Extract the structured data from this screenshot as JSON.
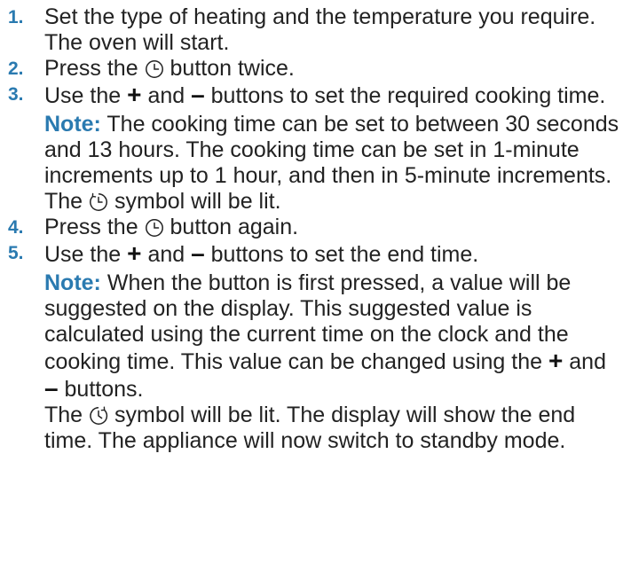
{
  "steps": [
    {
      "number": "1.",
      "line1": "Set the type of heating and the temperature you require.",
      "line2": "The oven will start."
    },
    {
      "number": "2.",
      "before_icon": "Press the",
      "icon": "clock-icon",
      "after_icon": "button twice."
    },
    {
      "number": "3.",
      "before_plus": "Use the",
      "plus": "+",
      "and": "and",
      "minus": "–",
      "after_minus": "buttons to set the required cooking time.",
      "note_label": "Note:",
      "note_text": "The cooking time can be set to between 30 seconds and 13 hours. The cooking time can be set in 1-minute increments up to 1 hour, and then in 5-minute increments.",
      "lit_before": "The",
      "lit_icon": "cooking-time-icon",
      "lit_after": "symbol will be lit."
    },
    {
      "number": "4.",
      "before_icon": "Press the",
      "icon": "clock-icon",
      "after_icon": "button again."
    },
    {
      "number": "5.",
      "before_plus": "Use the",
      "plus": "+",
      "and": "and",
      "minus": "–",
      "after_minus": "buttons to set the end time.",
      "note_label": "Note:",
      "note_text_1": "When the button is first pressed, a value will be suggested on the display. This suggested value is calculated using the current time on the clock and the cooking time. This value can be changed using the",
      "note_plus": "+",
      "note_and": "and",
      "note_minus": "–",
      "note_text_2": "buttons.",
      "lit_before": "The",
      "lit_icon": "end-time-icon",
      "lit_after": "symbol will be lit. The display will show the end time. The appliance will now switch to standby mode."
    }
  ],
  "colors": {
    "accent": "#2a7ab0",
    "text": "#222222"
  }
}
